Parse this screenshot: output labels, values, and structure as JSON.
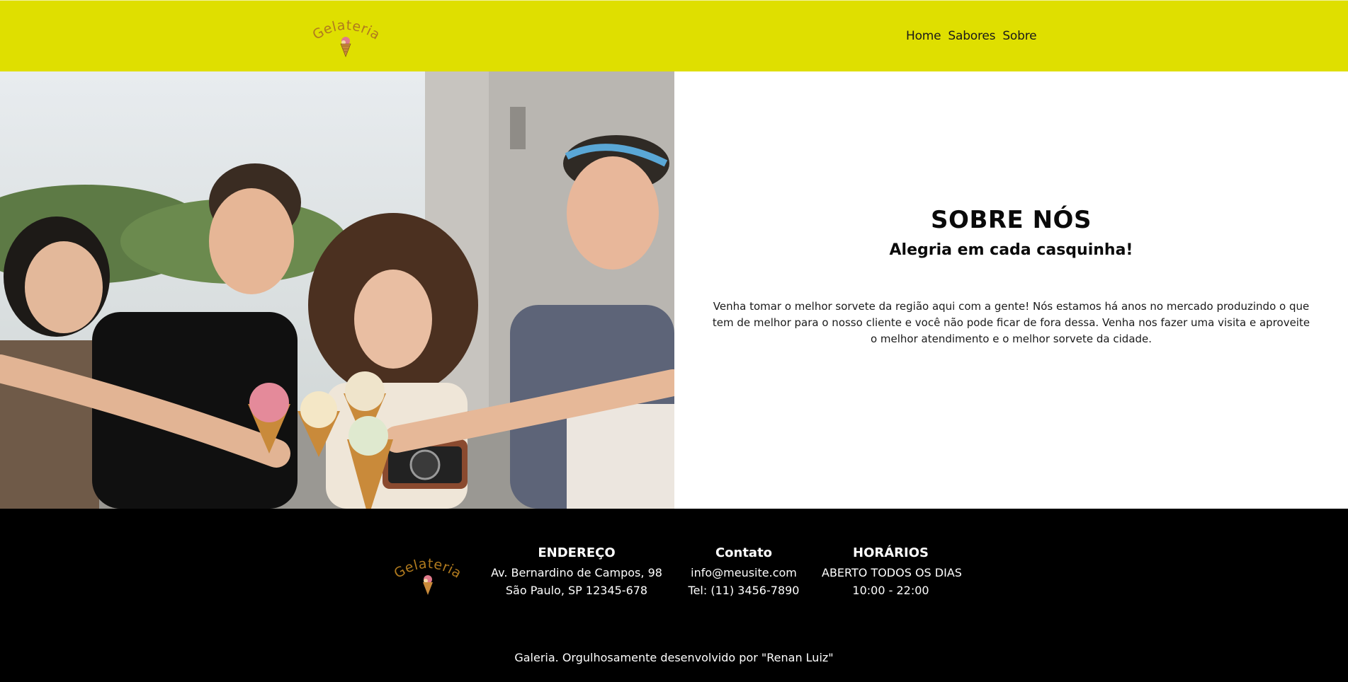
{
  "header": {
    "logo_text": "Gelateria",
    "nav": [
      {
        "label": "Home"
      },
      {
        "label": "Sabores"
      },
      {
        "label": "Sobre"
      }
    ]
  },
  "colors": {
    "header_bg": "#dfdf00",
    "footer_bg": "#000000",
    "logo_text": "#b07a1e"
  },
  "about": {
    "title": "SOBRE NÓS",
    "subtitle": "Alegria em cada casquinha!",
    "body": "Venha tomar o melhor sorvete da região aqui com a gente! Nós estamos há anos no mercado produzindo o que tem de melhor para o nosso cliente e você não pode ficar de fora dessa. Venha nos fazer uma visita e aproveite o melhor atendimento e o melhor sorvete da cidade."
  },
  "footer": {
    "logo_text": "Gelateria",
    "address": {
      "title": "ENDEREÇO",
      "line1": "Av. Bernardino de Campos, 98",
      "line2": "São Paulo, SP 12345-678"
    },
    "contact": {
      "title": "Contato",
      "line1": "info@meusite.com",
      "line2": "Tel: (11) 3456-7890"
    },
    "hours": {
      "title": "HORÁRIOS",
      "line1": "ABERTO TODOS OS DIAS",
      "line2": "10:00 - 22:00"
    },
    "credits": "Galeria. Orgulhosamente desenvolvido por \"Renan Luiz\""
  }
}
